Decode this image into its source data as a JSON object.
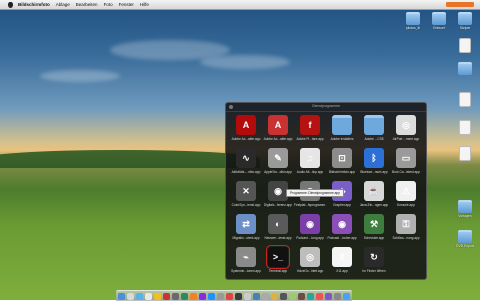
{
  "menubar": {
    "items": [
      "Bildschirmfoto",
      "Ablage",
      "Bearbeiten",
      "Foto",
      "Fenster",
      "Hilfe"
    ]
  },
  "desktop": {
    "icons": [
      {
        "label": "pilotos_iti",
        "kind": "folder"
      },
      {
        "label": "Entwurf",
        "kind": "folder"
      },
      {
        "label": "Skripte",
        "kind": "folder"
      },
      {
        "label": "",
        "kind": "doc"
      },
      {
        "label": "",
        "kind": "doc"
      },
      {
        "label": "",
        "kind": "folder"
      },
      {
        "label": "",
        "kind": "doc"
      },
      {
        "label": "",
        "kind": "doc"
      },
      {
        "label": "Vorlagen",
        "kind": "folder"
      },
      {
        "label": "DVD Export",
        "kind": "folder"
      }
    ]
  },
  "launcher": {
    "title": "Dienstprogramme",
    "tooltip": "Programme: Dienstprogramme.app",
    "apps": [
      {
        "label": "Adobe Ac...atter.app",
        "icon": "acrobat-icon",
        "glyph": "A",
        "color": "#b30b0b"
      },
      {
        "label": "Adobe Ac...atter.app",
        "icon": "acrobat-update-icon",
        "glyph": "A",
        "color": "#c83232"
      },
      {
        "label": "Adobe Fl...tare.app",
        "icon": "flash-icon",
        "glyph": "f",
        "color": "#b51212"
      },
      {
        "label": "Adobe Installers",
        "icon": "folder-icon",
        "glyph": "",
        "color": "#6fa8dc"
      },
      {
        "label": "Adobe ...CS5",
        "icon": "folder-icon",
        "glyph": "",
        "color": "#6fa8dc"
      },
      {
        "label": "AirPort ...ment.app",
        "icon": "airport-icon",
        "glyph": "◎",
        "color": "#dcdcdc"
      },
      {
        "label": "Aktivitäts-...nitor.app",
        "icon": "activity-monitor-icon",
        "glyph": "∿",
        "color": "#2a2a2a"
      },
      {
        "label": "AppleScr...ditor.app",
        "icon": "applescript-icon",
        "glyph": "✎",
        "color": "#9a9a9a"
      },
      {
        "label": "Audio-Mi...ilup.app",
        "icon": "audio-midi-icon",
        "glyph": "♫",
        "color": "#e6e6e6"
      },
      {
        "label": "Bildschirmfoto.app",
        "icon": "grab-icon",
        "glyph": "⊡",
        "color": "#8c8c8c"
      },
      {
        "label": "Bluetoot...nsch.app",
        "icon": "bluetooth-icon",
        "glyph": "ᛒ",
        "color": "#2c6fd6"
      },
      {
        "label": "Boot Ca...istent.app",
        "icon": "bootcamp-icon",
        "glyph": "▭",
        "color": "#9a9a9a"
      },
      {
        "label": "ColorSyn...ienst.app",
        "icon": "colorsync-icon",
        "glyph": "✕",
        "color": "#555"
      },
      {
        "label": "Digitalc...ferenz.app",
        "icon": "digital-color-icon",
        "glyph": "◉",
        "color": "#444"
      },
      {
        "label": "Festplat...fsprogramm.app",
        "icon": "disk-utility-icon",
        "glyph": "◍",
        "color": "#777"
      },
      {
        "label": "Grapher.app",
        "icon": "grapher-icon",
        "glyph": "◆",
        "color": "#7a5fc8"
      },
      {
        "label": "Java-Ein...ngen.app",
        "icon": "java-icon",
        "glyph": "☕",
        "color": "#d8d8d8"
      },
      {
        "label": "Konsole.app",
        "icon": "console-icon",
        "glyph": "⚠",
        "color": "#f0f0f0"
      },
      {
        "label": "Migratio...stent.app",
        "icon": "migration-icon",
        "glyph": "⇄",
        "color": "#6c8fc8"
      },
      {
        "label": "Netzwer...ienst.app",
        "icon": "network-utility-icon",
        "glyph": "◐",
        "color": "#5a5a5a"
      },
      {
        "label": "Podcast ...tung.app",
        "icon": "podcast-capture-icon",
        "glyph": "◉",
        "color": "#7b3fa8"
      },
      {
        "label": "Podcast ...bsher.app",
        "icon": "podcast-publisher-icon",
        "glyph": "◉",
        "color": "#8b4fb8"
      },
      {
        "label": "Scheduler.app",
        "icon": "scheduler-icon",
        "glyph": "⚒",
        "color": "#3d7d3d"
      },
      {
        "label": "Schlüss...nung.app",
        "icon": "keychain-icon",
        "glyph": "⚿",
        "color": "#b0b0b0"
      },
      {
        "label": "Systemin...ionen.app",
        "icon": "system-info-icon",
        "glyph": "⌁",
        "color": "#8a8a8a"
      },
      {
        "label": "Terminal.app",
        "icon": "terminal-icon",
        "glyph": ">_",
        "color": "#111"
      },
      {
        "label": "VoiceOv...lntet.app",
        "icon": "voiceover-icon",
        "glyph": "◎",
        "color": "#bdbdbd"
      },
      {
        "label": "X11.app",
        "icon": "x11-icon",
        "glyph": "X",
        "color": "#f5f5f5"
      },
      {
        "label": "Im Finder öffnen",
        "icon": "open-in-finder-icon",
        "glyph": "↻",
        "color": "#2a2a2a"
      }
    ]
  },
  "dock": {
    "colors": [
      "#4a90d9",
      "#d9d9d9",
      "#5ab0e8",
      "#e8e8e8",
      "#f0c020",
      "#c33",
      "#6a6a6a",
      "#2e8b57",
      "#f58220",
      "#8a2be2",
      "#1e90ff",
      "#999",
      "#d44",
      "#3a3a3a",
      "#ccc",
      "#4682b4",
      "#aaa",
      "#e0b040",
      "#555",
      "#9ccc65",
      "#6d4c41",
      "#26a69a",
      "#ef5350",
      "#7e57c2",
      "#888",
      "#42a5f5"
    ]
  }
}
